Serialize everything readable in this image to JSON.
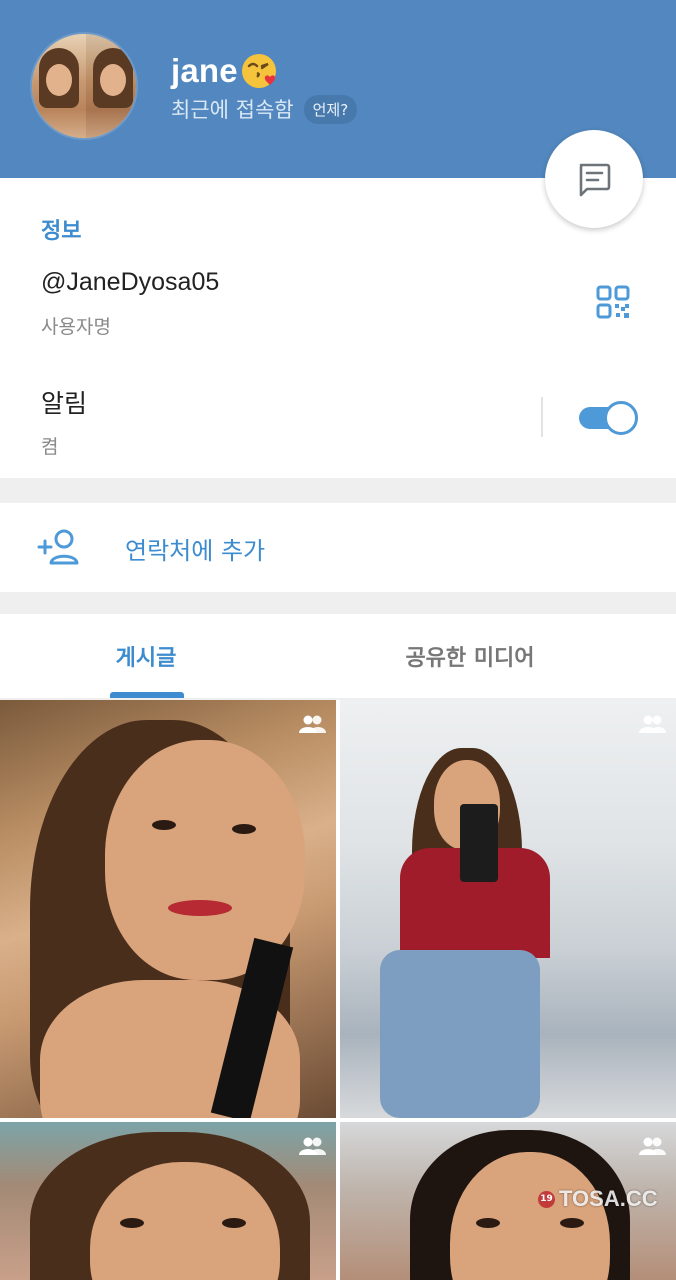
{
  "header": {
    "name": "jane",
    "name_emoji": "kissing-heart-emoji",
    "status": "최근에 접속함",
    "when_badge": "언제?",
    "bg_color": "#5288bf"
  },
  "fab": {
    "icon": "message-icon"
  },
  "info": {
    "section_title": "정보",
    "username": "@JaneDyosa05",
    "username_label": "사용자명",
    "notifications_label": "알림",
    "notifications_state": "켬",
    "notifications_on": true,
    "qr_icon": "qr-code-icon"
  },
  "add_contact": {
    "label": "연락처에 추가",
    "icon": "add-user-icon"
  },
  "tabs": [
    {
      "label": "게시글",
      "active": true
    },
    {
      "label": "공유한 미디어",
      "active": false
    }
  ],
  "media": [
    {
      "icon": "group-icon",
      "desc": "selfie-photo"
    },
    {
      "icon": "group-icon",
      "desc": "mirror-selfie-photo"
    },
    {
      "icon": "group-icon",
      "desc": "selfie-photo"
    },
    {
      "icon": "group-icon",
      "desc": "selfie-photo"
    }
  ],
  "watermark": {
    "badge": "19",
    "text": "TOSA.CC"
  },
  "colors": {
    "accent": "#3d8ccf",
    "toggle": "#4e9ad8"
  }
}
